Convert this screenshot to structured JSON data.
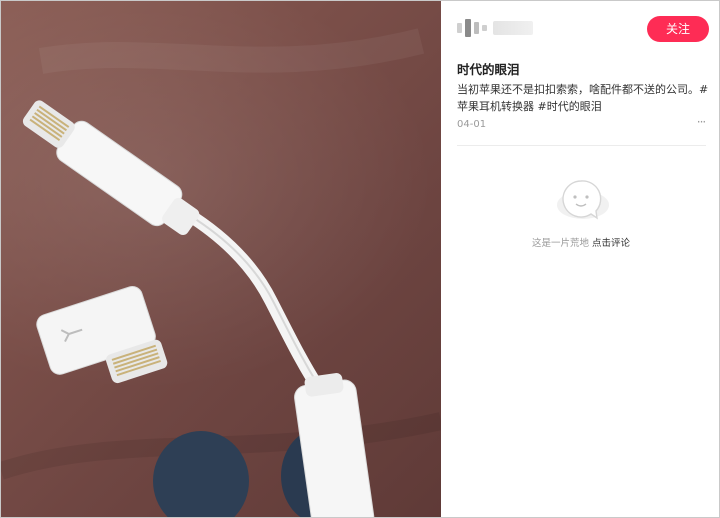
{
  "post": {
    "follow_label": "关注",
    "title": "时代的眼泪",
    "body_text": "当初苹果还不是扣扣索索，啥配件都不送的公司。",
    "tags": [
      "#苹果耳机转换器",
      "#时代的眼泪"
    ],
    "date": "04-01",
    "more_label": "···"
  },
  "comments": {
    "empty_text": "这是一片荒地",
    "empty_link": "点击评论"
  },
  "icons": {
    "follow": "none",
    "more": "more-dots-icon",
    "empty": "empty-chat-bubble-icon"
  },
  "colors": {
    "accent": "#fe2c55",
    "photo_background": "#7b4f49"
  }
}
